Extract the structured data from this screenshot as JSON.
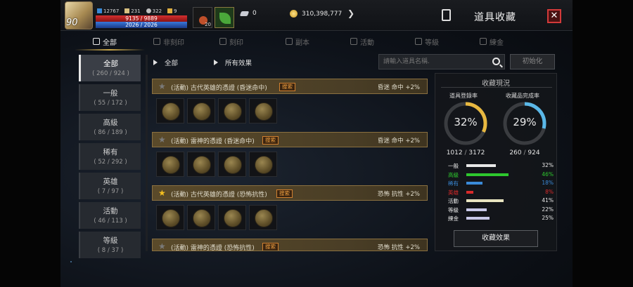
{
  "player": {
    "level": "90",
    "stats": [
      "12767",
      "231",
      "322",
      "9"
    ],
    "hp": "9135 / 9889",
    "mp": "2026 / 2026",
    "pet_count": "20"
  },
  "currency": {
    "silver": "0",
    "gold": "310,398,777"
  },
  "window_title": "道具收藏",
  "close_glyph": "✕",
  "tabs": [
    {
      "label": "全部"
    },
    {
      "label": "非刻印"
    },
    {
      "label": "刻印"
    },
    {
      "label": "副本"
    },
    {
      "label": "活動"
    },
    {
      "label": "等級"
    },
    {
      "label": "練金"
    }
  ],
  "categories": [
    {
      "name": "全部",
      "count": "( 260 / 924 )"
    },
    {
      "name": "一般",
      "count": "( 55 / 172 )"
    },
    {
      "name": "高級",
      "count": "( 86 / 189 )"
    },
    {
      "name": "稀有",
      "count": "( 52 / 292 )"
    },
    {
      "name": "英雄",
      "count": "( 7 / 97 )"
    },
    {
      "name": "活動",
      "count": "( 46 / 113 )"
    },
    {
      "name": "等級",
      "count": "( 8 / 37 )"
    }
  ],
  "filters": {
    "grade": "全部",
    "effect": "所有效果"
  },
  "search": {
    "placeholder": "請輸入道具名稱."
  },
  "init_button": "初始化",
  "collections": [
    {
      "name": "(活動) 古代英雄的憑證 (昏迷命中)",
      "badge": "搜索",
      "effect": "昏迷 命中 +2%",
      "starred": false
    },
    {
      "name": "(活動) 雷神的憑證 (昏迷命中)",
      "badge": "搜索",
      "effect": "昏迷 命中 +2%",
      "starred": false
    },
    {
      "name": "(活動) 古代英雄的憑證 (恐怖抗性)",
      "badge": "搜索",
      "effect": "恐怖 抗性 +2%",
      "starred": true
    },
    {
      "name": "(活動) 雷神的憑證 (恐怖抗性)",
      "badge": "搜索",
      "effect": "恐怖 抗性 +2%",
      "starred": false
    }
  ],
  "panel": {
    "title": "收藏現況",
    "item_rate_label": "道具登錄率",
    "item_rate": "32%",
    "item_rate_value": 32,
    "item_count": "1012",
    "item_total": "3172",
    "complete_rate_label": "收藏品完成率",
    "complete_rate": "29%",
    "complete_rate_value": 29,
    "complete_count": "260",
    "complete_total": "924",
    "breakdown": [
      {
        "label": "一般",
        "pct": "32%",
        "value": 32,
        "color": "#e8e8e8",
        "label_color": "#e8e8e8"
      },
      {
        "label": "高級",
        "pct": "46%",
        "value": 46,
        "color": "#2ec82e",
        "label_color": "#2ec82e"
      },
      {
        "label": "稀有",
        "pct": "18%",
        "value": 18,
        "color": "#3a8ad8",
        "label_color": "#3a8ad8"
      },
      {
        "label": "英雄",
        "pct": "8%",
        "value": 8,
        "color": "#d82a2a",
        "label_color": "#d82a2a"
      },
      {
        "label": "活動",
        "pct": "41%",
        "value": 41,
        "color": "#e8e4c0",
        "label_color": "#e8e8e8"
      },
      {
        "label": "等級",
        "pct": "22%",
        "value": 22,
        "color": "#c8c8e8",
        "label_color": "#e8e8e8"
      },
      {
        "label": "練金",
        "pct": "25%",
        "value": 25,
        "color": "#c8c8e8",
        "label_color": "#e8e8e8"
      }
    ],
    "effect_button": "收藏效果"
  },
  "colors": {
    "ring_left": "#e8b840",
    "ring_right": "#5ab8e8",
    "accent_gold": "#c9a64a",
    "close_red": "#d23a3a"
  }
}
